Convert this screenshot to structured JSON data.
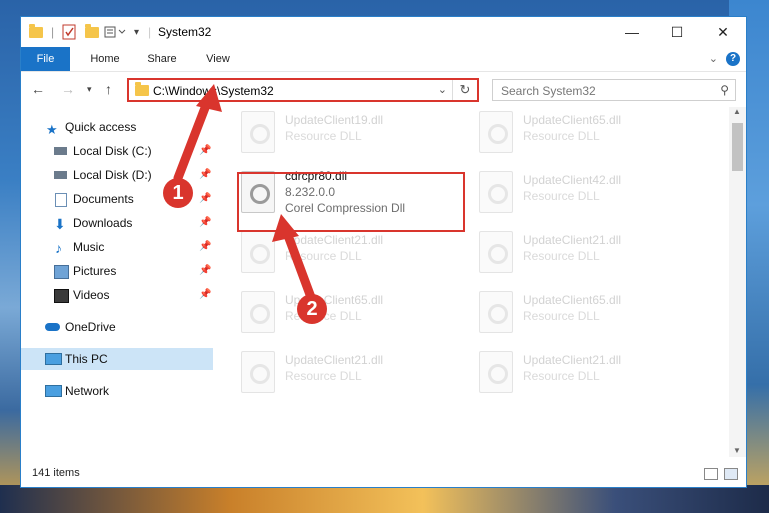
{
  "window": {
    "title": "System32",
    "quick_access_toolbar_icons": [
      "folder-icon",
      "properties-icon",
      "new-folder-icon",
      "customize-icon"
    ]
  },
  "ribbon": {
    "tabs": [
      "File",
      "Home",
      "Share",
      "View"
    ]
  },
  "address_bar": {
    "path": "C:\\Windows\\System32",
    "search_placeholder": "Search System32"
  },
  "sidebar": {
    "items": [
      {
        "label": "Quick access",
        "icon": "star-icon"
      },
      {
        "label": "Local Disk (C:)",
        "icon": "drive-icon"
      },
      {
        "label": "Local Disk (D:)",
        "icon": "drive-icon"
      },
      {
        "label": "Documents",
        "icon": "documents-icon"
      },
      {
        "label": "Downloads",
        "icon": "downloads-icon"
      },
      {
        "label": "Music",
        "icon": "music-icon"
      },
      {
        "label": "Pictures",
        "icon": "pictures-icon"
      },
      {
        "label": "Videos",
        "icon": "videos-icon"
      },
      {
        "label": "OneDrive",
        "icon": "cloud-icon"
      },
      {
        "label": "This PC",
        "icon": "computer-icon",
        "selected": true
      },
      {
        "label": "Network",
        "icon": "network-icon"
      }
    ]
  },
  "files": {
    "left": [
      {
        "name": "UpdateClient19.dll",
        "type": "Resource DLL"
      },
      {
        "name": "cdrcpr80.dll",
        "type": "8.232.0.0",
        "desc": "Corel Compression Dll",
        "active": true
      },
      {
        "name": "UpdateClient21.dll",
        "type": "Resource DLL"
      },
      {
        "name": "UpdateClient65.dll",
        "type": "Resource DLL"
      },
      {
        "name": "UpdateClient21.dll",
        "type": "Resource DLL"
      }
    ],
    "right": [
      {
        "name": "UpdateClient65.dll",
        "type": "Resource DLL"
      },
      {
        "name": "UpdateClient42.dll",
        "type": "Resource DLL"
      },
      {
        "name": "UpdateClient21.dll",
        "type": "Resource DLL"
      },
      {
        "name": "UpdateClient65.dll",
        "type": "Resource DLL"
      },
      {
        "name": "UpdateClient21.dll",
        "type": "Resource DLL"
      }
    ]
  },
  "status": {
    "item_count": "141 items"
  },
  "annotations": {
    "badge_1": "1",
    "badge_2": "2",
    "color": "#d9352d"
  }
}
